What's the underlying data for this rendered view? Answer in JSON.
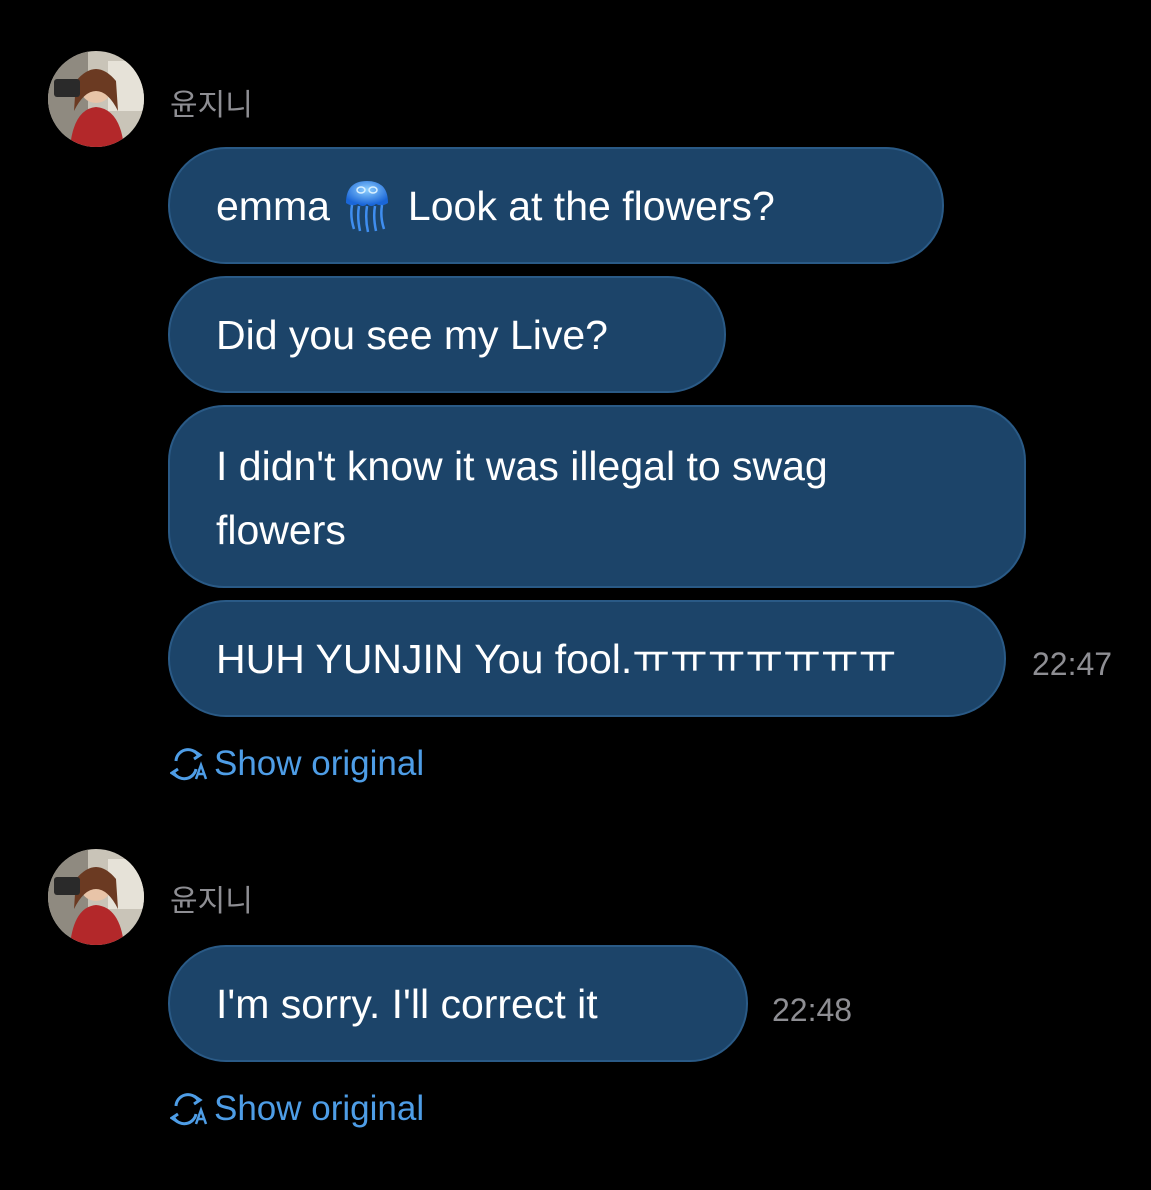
{
  "groups": [
    {
      "sender": "윤지니",
      "messages": [
        {
          "text_before_emoji": "emma",
          "emoji": "jellyfish-icon",
          "text_after_emoji": "Look at the flowers?"
        },
        {
          "text": "Did you see my Live?"
        },
        {
          "line1": "I didn't know it was illegal to swag",
          "line2": "flowers"
        },
        {
          "text": "HUH YUNJIN You fool.ㅠㅠㅠㅠㅠㅠㅠ"
        }
      ],
      "time": "22:47",
      "show_original": "Show original",
      "show_original_icon": "translate-icon"
    },
    {
      "sender": "윤지니",
      "messages": [
        {
          "text": "I'm sorry. I'll correct it"
        }
      ],
      "time": "22:48",
      "show_original": "Show original",
      "show_original_icon": "translate-icon"
    }
  ],
  "colors": {
    "background": "#000000",
    "bubble": "#1c4469",
    "link": "#4e9de6",
    "meta_text": "#8e8e93"
  }
}
